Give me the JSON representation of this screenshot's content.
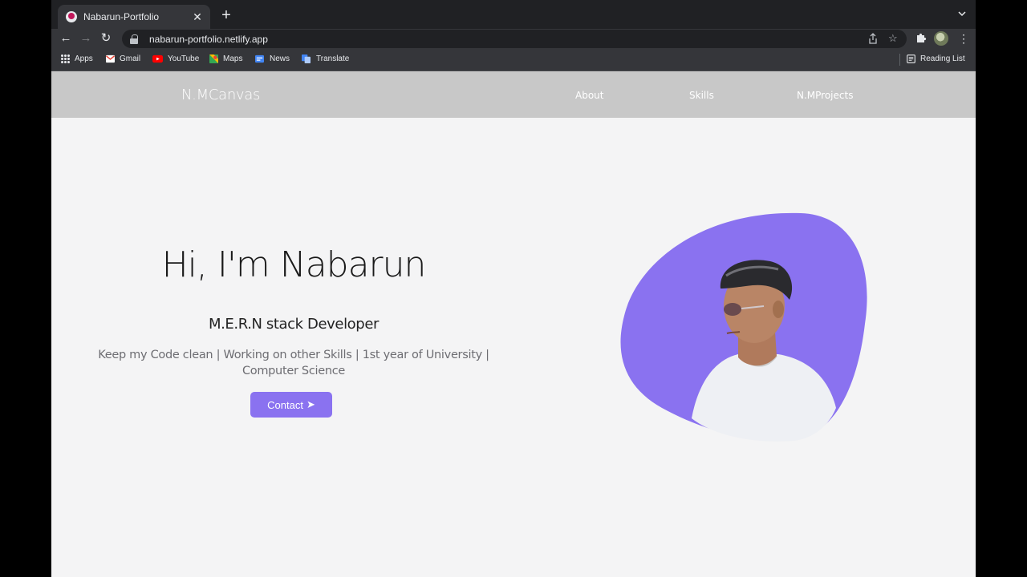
{
  "browser": {
    "tab_title": "Nabarun-Portfolio",
    "tab_close": "✕",
    "new_tab": "+",
    "url": "nabarun-portfolio.netlify.app",
    "bookmarks": [
      {
        "label": "Apps",
        "icon": "apps-grid-icon"
      },
      {
        "label": "Gmail",
        "icon": "gmail-icon"
      },
      {
        "label": "YouTube",
        "icon": "youtube-icon"
      },
      {
        "label": "Maps",
        "icon": "maps-icon"
      },
      {
        "label": "News",
        "icon": "news-icon"
      },
      {
        "label": "Translate",
        "icon": "translate-icon"
      }
    ],
    "reading_list": "Reading List"
  },
  "site": {
    "brand": "N.MCanvas",
    "nav": [
      {
        "label": "About"
      },
      {
        "label": "Skills"
      },
      {
        "label": "N.MProjects"
      }
    ],
    "hero": {
      "title": "Hi, I'm Nabarun",
      "role": "M.E.R.N stack Developer",
      "description": "Keep my Code clean | Working on other Skills | 1st year of University | Computer Science",
      "cta_label": "Contact",
      "cta_arrow": "➤"
    }
  },
  "colors": {
    "accent": "#8a72f0",
    "nav_bg": "#c8c8c8",
    "page_bg": "#f4f4f5",
    "browser_dark": "#202124",
    "browser_mid": "#35363a"
  }
}
